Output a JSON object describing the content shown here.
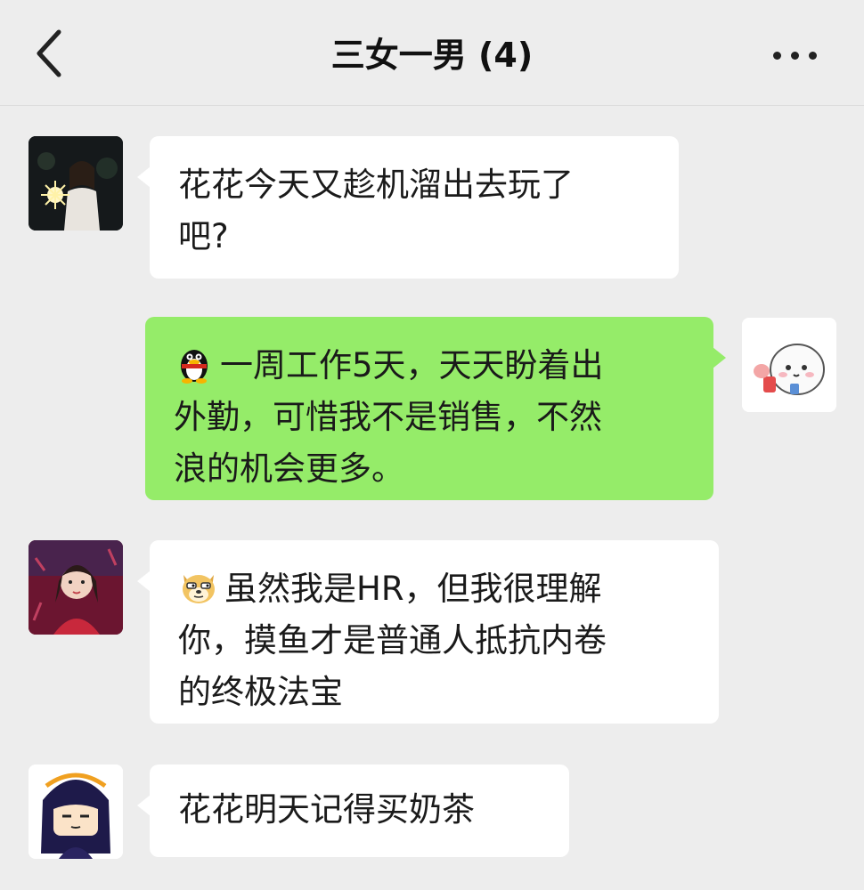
{
  "header": {
    "title": "三女一男 (4)",
    "back_icon": "chevron-left-icon",
    "more_icon": "more-dots-icon"
  },
  "colors": {
    "background": "#ededed",
    "incoming_bubble": "#ffffff",
    "outgoing_bubble": "#95ec69"
  },
  "messages": [
    {
      "direction": "incoming",
      "avatar": "girl-sparkler-night-avatar",
      "lines": [
        "花花今天又趁机溜出去玩了",
        "吧?"
      ]
    },
    {
      "direction": "outgoing",
      "avatar": "cartoon-bun-avatar",
      "emoji": "penguin-emoji",
      "lines": [
        "一周工作5天，天天盼着出",
        "外勤，可惜我不是销售，不然",
        "浪的机会更多。"
      ]
    },
    {
      "direction": "incoming",
      "avatar": "girl-red-background-avatar",
      "emoji": "doge-emoji",
      "lines": [
        "虽然我是HR，但我很理解",
        "你，摸鱼才是普通人抵抗内卷",
        "的终极法宝"
      ]
    },
    {
      "direction": "incoming",
      "avatar": "anime-girl-avatar",
      "lines": [
        "花花明天记得买奶茶"
      ]
    }
  ]
}
